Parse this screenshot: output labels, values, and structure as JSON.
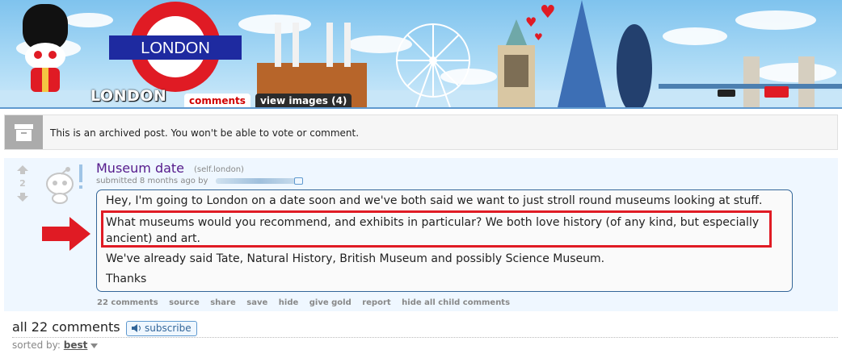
{
  "header": {
    "sign_text": "LONDON",
    "subreddit_name": "LONDON",
    "tab_comments": "comments",
    "tab_images": "view images (4)"
  },
  "archived": {
    "message": "This is an archived post. You won't be able to vote or comment."
  },
  "post": {
    "score": "2",
    "title": "Museum date",
    "domain": "(self.london)",
    "tagline": "submitted 8 months ago by",
    "paragraphs": [
      "Hey, I'm going to London on a date soon and we've both said we want to just stroll round museums looking at stuff.",
      "What museums would you recommend, and exhibits in particular? We both love history (of any kind, but especially",
      "ancient) and art.",
      "We've already said Tate, Natural History, British Museum and possibly Science Museum.",
      "Thanks"
    ],
    "buttons": [
      "22 comments",
      "source",
      "share",
      "save",
      "hide",
      "give gold",
      "report",
      "hide all child comments"
    ]
  },
  "comments": {
    "count_label": "all 22 comments",
    "subscribe_label": "subscribe",
    "sorted_by_label": "sorted by:",
    "sort_value": "best"
  },
  "colors": {
    "link_purple": "#551a8b",
    "highlight_red": "#e01b24",
    "post_bg": "#eff7ff",
    "archived_bg": "#ababab"
  }
}
